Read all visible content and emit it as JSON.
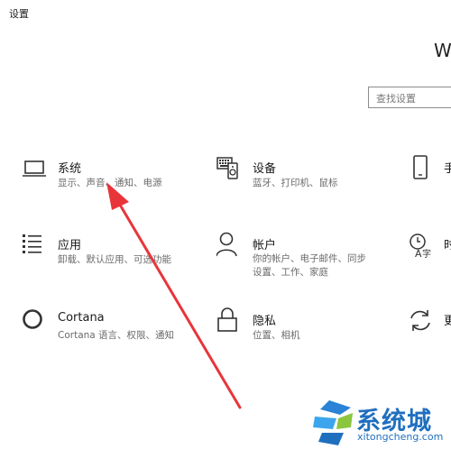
{
  "window": {
    "title": "设置"
  },
  "header": {
    "big_text": "W"
  },
  "search": {
    "placeholder": "查找设置"
  },
  "tiles": [
    {
      "title": "系统",
      "subtitle": "显示、声音、通知、电源",
      "icon": "laptop-icon"
    },
    {
      "title": "设备",
      "subtitle": "蓝牙、打印机、鼠标",
      "icon": "keyboard-icon"
    },
    {
      "title": "应用",
      "subtitle": "卸载、默认应用、可选功能",
      "icon": "apps-list-icon"
    },
    {
      "title": "帐户",
      "subtitle": "你的帐户、电子邮件、同步设置、工作、家庭",
      "icon": "person-icon"
    },
    {
      "title": "Cortana",
      "subtitle": "Cortana 语言、权限、通知",
      "icon": "cortana-icon"
    },
    {
      "title": "隐私",
      "subtitle": "位置、相机",
      "icon": "lock-icon"
    }
  ],
  "right_column": [
    {
      "title": "手",
      "icon": "phone-icon"
    },
    {
      "title": "时",
      "icon": "time-language-icon"
    },
    {
      "title": "更",
      "icon": "update-icon"
    }
  ],
  "watermark": {
    "text": "系统城",
    "url": "xitongcheng.com"
  },
  "colors": {
    "arrow": "#e8353a",
    "watermark_blue": "#1f6fbf"
  }
}
